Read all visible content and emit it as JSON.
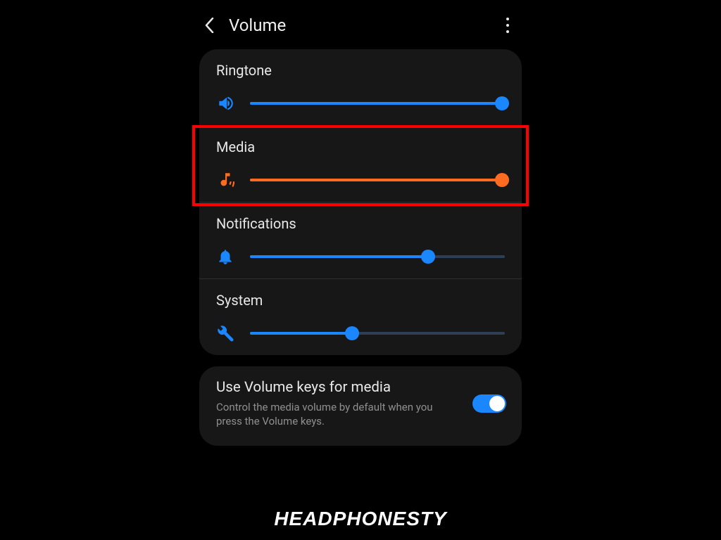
{
  "header": {
    "title": "Volume"
  },
  "sliders": {
    "ringtone": {
      "label": "Ringtone",
      "percent": 99,
      "color": "blue",
      "icon": "speaker-icon"
    },
    "media": {
      "label": "Media",
      "percent": 99,
      "color": "orange",
      "icon": "music-note-icon",
      "highlighted": true
    },
    "notifications": {
      "label": "Notifications",
      "percent": 70,
      "color": "blue",
      "icon": "bell-icon"
    },
    "system": {
      "label": "System",
      "percent": 40,
      "color": "blue",
      "icon": "wrench-icon"
    }
  },
  "toggle": {
    "title": "Use Volume keys for media",
    "subtitle": "Control the media volume by default when you press the Volume keys.",
    "on": true
  },
  "watermark": "HEADPHONESTY",
  "colors": {
    "blue": "#1a86ff",
    "orange": "#ff6b1f",
    "highlight": "#ff0000"
  }
}
